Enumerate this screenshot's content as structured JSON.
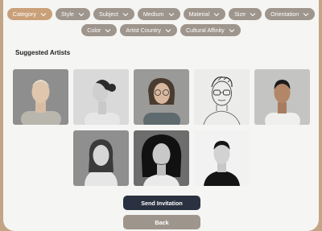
{
  "filters": {
    "row1": [
      {
        "label": "Category",
        "active": true
      },
      {
        "label": "Style",
        "active": false
      },
      {
        "label": "Subject",
        "active": false
      },
      {
        "label": "Medium",
        "active": false
      },
      {
        "label": "Material",
        "active": false
      },
      {
        "label": "Size",
        "active": false
      },
      {
        "label": "Orientation",
        "active": false
      }
    ],
    "row2": [
      {
        "label": "Color",
        "active": false
      },
      {
        "label": "Artist Country",
        "active": false
      },
      {
        "label": "Cultural Affinity",
        "active": false
      }
    ]
  },
  "section_title": "Suggested Artists",
  "artists": {
    "row1": [
      {
        "name": "artist-1",
        "kind": "photo-older-man"
      },
      {
        "name": "artist-2",
        "kind": "photo-profile-woman"
      },
      {
        "name": "artist-3",
        "kind": "photo-woman-glasses"
      },
      {
        "name": "artist-4",
        "kind": "sketch-man-glasses"
      },
      {
        "name": "artist-5",
        "kind": "photo-young-man"
      }
    ],
    "row2": [
      {
        "name": "artist-6",
        "kind": "photo-woman-hair"
      },
      {
        "name": "artist-7",
        "kind": "photo-woman-bw"
      },
      {
        "name": "artist-8",
        "kind": "photo-man-dark-bg"
      }
    ]
  },
  "buttons": {
    "send_invitation": "Send Invitation",
    "back": "Back"
  },
  "colors": {
    "background": "#c2a584",
    "panel": "#f5f5f3",
    "chip": "#9e958c",
    "chip_active": "#c9a079",
    "primary_button": "#2a3140"
  }
}
